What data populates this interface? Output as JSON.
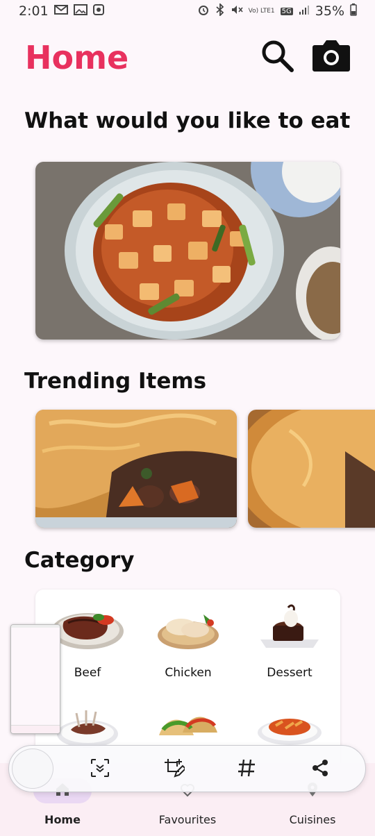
{
  "status_bar": {
    "time": "2:01",
    "notification_icons": [
      "gmail-icon",
      "photo-icon",
      "app-icon"
    ],
    "network_label": "Vo) LTE1",
    "network_type": "5G",
    "battery": "35%"
  },
  "header": {
    "title": "Home",
    "title_color": "#e8315e",
    "search_icon": "search-icon",
    "camera_icon": "camera-icon"
  },
  "main": {
    "prompt_title": "What would you like to eat",
    "trending_title": "Trending Items",
    "category_title": "Category",
    "categories": [
      {
        "label": "Beef",
        "icon": "beef-image"
      },
      {
        "label": "Chicken",
        "icon": "chicken-image"
      },
      {
        "label": "Dessert",
        "icon": "dessert-image"
      },
      {
        "label": "",
        "icon": "lamb-image"
      },
      {
        "label": "",
        "icon": "taco-image"
      },
      {
        "label": "",
        "icon": "pasta-image"
      }
    ]
  },
  "bottom_nav": {
    "items": [
      {
        "label": "Home",
        "icon": "home-icon",
        "active": true
      },
      {
        "label": "Favourites",
        "icon": "heart-icon",
        "active": false
      },
      {
        "label": "Cuisines",
        "icon": "location-pin-icon",
        "active": false
      }
    ],
    "active_color": "#ead8f3"
  },
  "overlay_toolbar": {
    "buttons": [
      "scan-icon",
      "edit-crop-icon",
      "hashtag-icon",
      "share-icon"
    ]
  }
}
